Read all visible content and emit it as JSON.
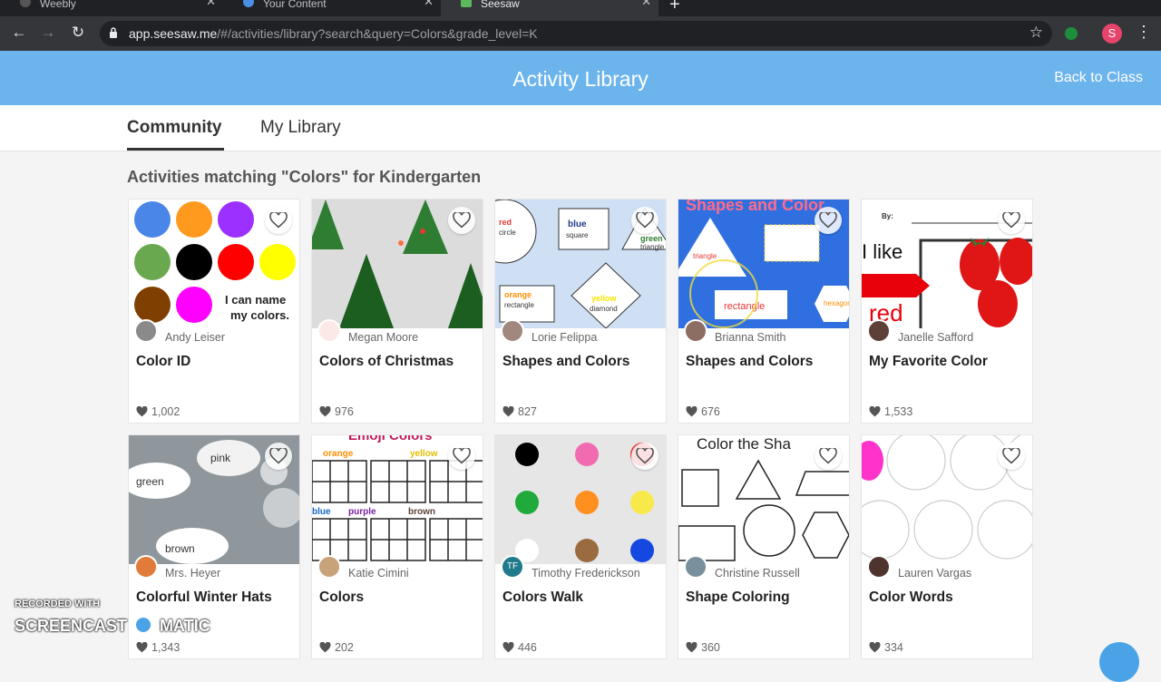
{
  "browser": {
    "tabs": [
      {
        "label": "Weebly",
        "active": false
      },
      {
        "label": "Your Content",
        "active": false
      },
      {
        "label": "Seesaw",
        "active": true
      }
    ],
    "url_host": "app.seesaw.me",
    "url_path": "/#/activities/library?search&query=Colors&grade_level=K",
    "profile_initial": "S"
  },
  "header": {
    "title": "Activity Library",
    "back_label": "Back to Class",
    "color": "#6cb4ec"
  },
  "library_tabs": [
    {
      "label": "Community",
      "active": true
    },
    {
      "label": "My Library",
      "active": false
    }
  ],
  "section_heading": "Activities matching \"Colors\" for Kindergarten",
  "cards": [
    {
      "title": "Color ID",
      "author": "Andy Leiser",
      "likes": "1,002",
      "thumb_text": [
        "I can name",
        "my colors."
      ]
    },
    {
      "title": "Colors of Christmas",
      "author": "Megan Moore",
      "likes": "976"
    },
    {
      "title": "Shapes and Colors",
      "author": "Lorie Felippa",
      "likes": "827",
      "thumb_text": [
        "red",
        "circle",
        "blue",
        "square",
        "green",
        "triangle",
        "orange",
        "rectangle",
        "yellow",
        "diamond"
      ]
    },
    {
      "title": "Shapes and Colors",
      "author": "Brianna Smith",
      "likes": "676",
      "thumb_text": [
        "Shapes and Color",
        "triangle",
        "rectangle",
        "hexagon"
      ]
    },
    {
      "title": "My Favorite Color",
      "author": "Janelle Safford",
      "likes": "1,533",
      "thumb_text": [
        "By:",
        "I like",
        "red"
      ]
    },
    {
      "title": "Colorful Winter Hats",
      "author": "Mrs. Heyer",
      "likes": "1,343",
      "thumb_text": [
        "pink",
        "green",
        "brown"
      ]
    },
    {
      "title": "Colors",
      "author": "Katie Cimini",
      "likes": "202",
      "thumb_text": [
        "Emoji Colors",
        "orange",
        "yellow",
        "purple",
        "brown",
        "blue"
      ]
    },
    {
      "title": "Colors Walk",
      "author": "Timothy Frederickson",
      "likes": "446",
      "avatar_initials": "TF"
    },
    {
      "title": "Shape Coloring",
      "author": "Christine Russell",
      "likes": "360",
      "thumb_text": [
        "Color the Sha"
      ]
    },
    {
      "title": "Color Words",
      "author": "Lauren Vargas",
      "likes": "334"
    }
  ],
  "watermark": {
    "line1": "RECORDED WITH",
    "line2": "SCREENCAST",
    "line3": "MATIC"
  }
}
